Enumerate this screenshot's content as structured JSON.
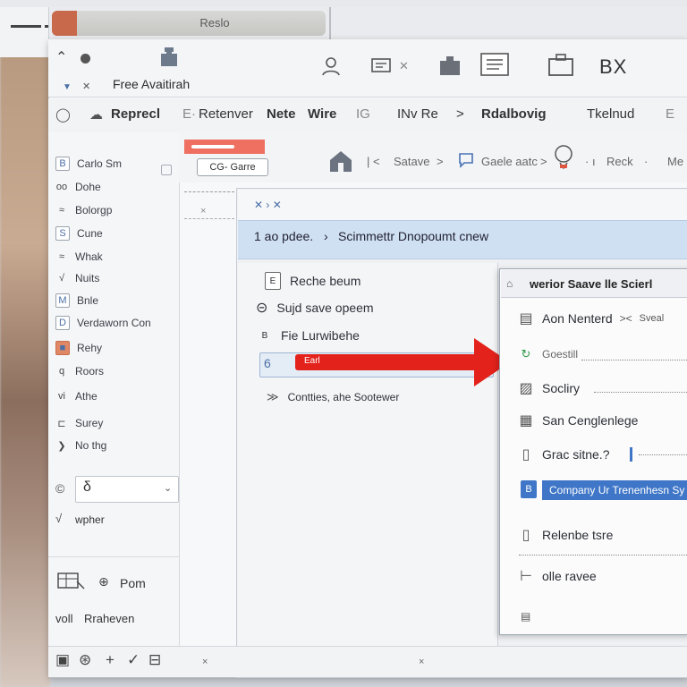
{
  "browser": {
    "tab_title": "Reslo"
  },
  "app": {
    "title": "Free Avaitirah",
    "toolbar_text": "BX",
    "icons": [
      "puzzle-icon",
      "user-icon",
      "print-icon",
      "extension-icon",
      "document-icon",
      "briefcase-icon"
    ]
  },
  "ribbon": {
    "items": [
      {
        "label": "Reprecl",
        "style": "bold"
      },
      {
        "label": "Retenver",
        "style": "normal"
      },
      {
        "label": "Nete",
        "style": "bold"
      },
      {
        "label": "Wire",
        "style": "bold"
      },
      {
        "label": "IG",
        "style": "light"
      },
      {
        "label": "INv Re",
        "style": "normal"
      },
      {
        "label": ">",
        "style": "normal"
      },
      {
        "label": "Rdalbovig",
        "style": "bold"
      },
      {
        "label": "Tkelnud",
        "style": "normal"
      },
      {
        "label": "E",
        "style": "light"
      }
    ]
  },
  "sidebar": {
    "items": [
      {
        "label": "Carlo Sm",
        "icon": "B"
      },
      {
        "label": "Dohe",
        "icon": "oo"
      },
      {
        "label": "Bolorgp",
        "icon": "≈"
      },
      {
        "label": "Cune",
        "icon": "S"
      },
      {
        "label": "Whak",
        "icon": "≈"
      },
      {
        "label": "Nuits",
        "icon": "√"
      },
      {
        "label": "Bnle",
        "icon": "M"
      },
      {
        "label": "Verdaworn Con",
        "icon": "D"
      },
      {
        "label": "Rehy",
        "icon": "■"
      },
      {
        "label": "Roors",
        "icon": "q"
      },
      {
        "label": "Athe",
        "icon": "vi"
      },
      {
        "label": "Surey",
        "icon": "⊏"
      },
      {
        "label": "No thg",
        "icon": "❯"
      }
    ],
    "dropdown_value": "δ",
    "extra_item": "wpher",
    "bottom_items": [
      {
        "label": "Pom"
      },
      {
        "label": "Rraheven",
        "prefix": "voll"
      }
    ]
  },
  "content_header": {
    "search_label": "CG- Garre",
    "nav": {
      "item1": "Satave",
      "item2": "Gaele aatc",
      "item3": "Reck",
      "item4": "Me"
    }
  },
  "panel": {
    "banner_prefix": "1 ao pdee.",
    "banner_text": "Scimmettr Dnopoumt cnew",
    "list": [
      {
        "label": "Reche beum",
        "icon": "E"
      },
      {
        "label": "Sujd save opeem",
        "icon": "⊝"
      },
      {
        "label": "Fie Lurwibehe",
        "icon": "B"
      },
      {
        "label": "Earl",
        "icon": "6",
        "selected": true
      },
      {
        "label": "Contties, ahe Sootewer",
        "icon": "≫"
      }
    ]
  },
  "dialog": {
    "title": "werior Saave lle Scierl",
    "rows": [
      {
        "label": "Aon Nenterd",
        "extra": "Sveal"
      },
      {
        "label": "Goestill"
      },
      {
        "label": "Socliry"
      },
      {
        "label": "San Cenglenlege"
      },
      {
        "label": "Grac sitne.?"
      },
      {
        "label": "Company Ur Trenenhesn Sy",
        "selected": true
      },
      {
        "label": "Relenbe tsre"
      },
      {
        "label": "olle ravee"
      }
    ]
  },
  "colors": {
    "accent": "#3f76c7",
    "arrow": "#e4221c",
    "banner": "#cfe0f3"
  }
}
